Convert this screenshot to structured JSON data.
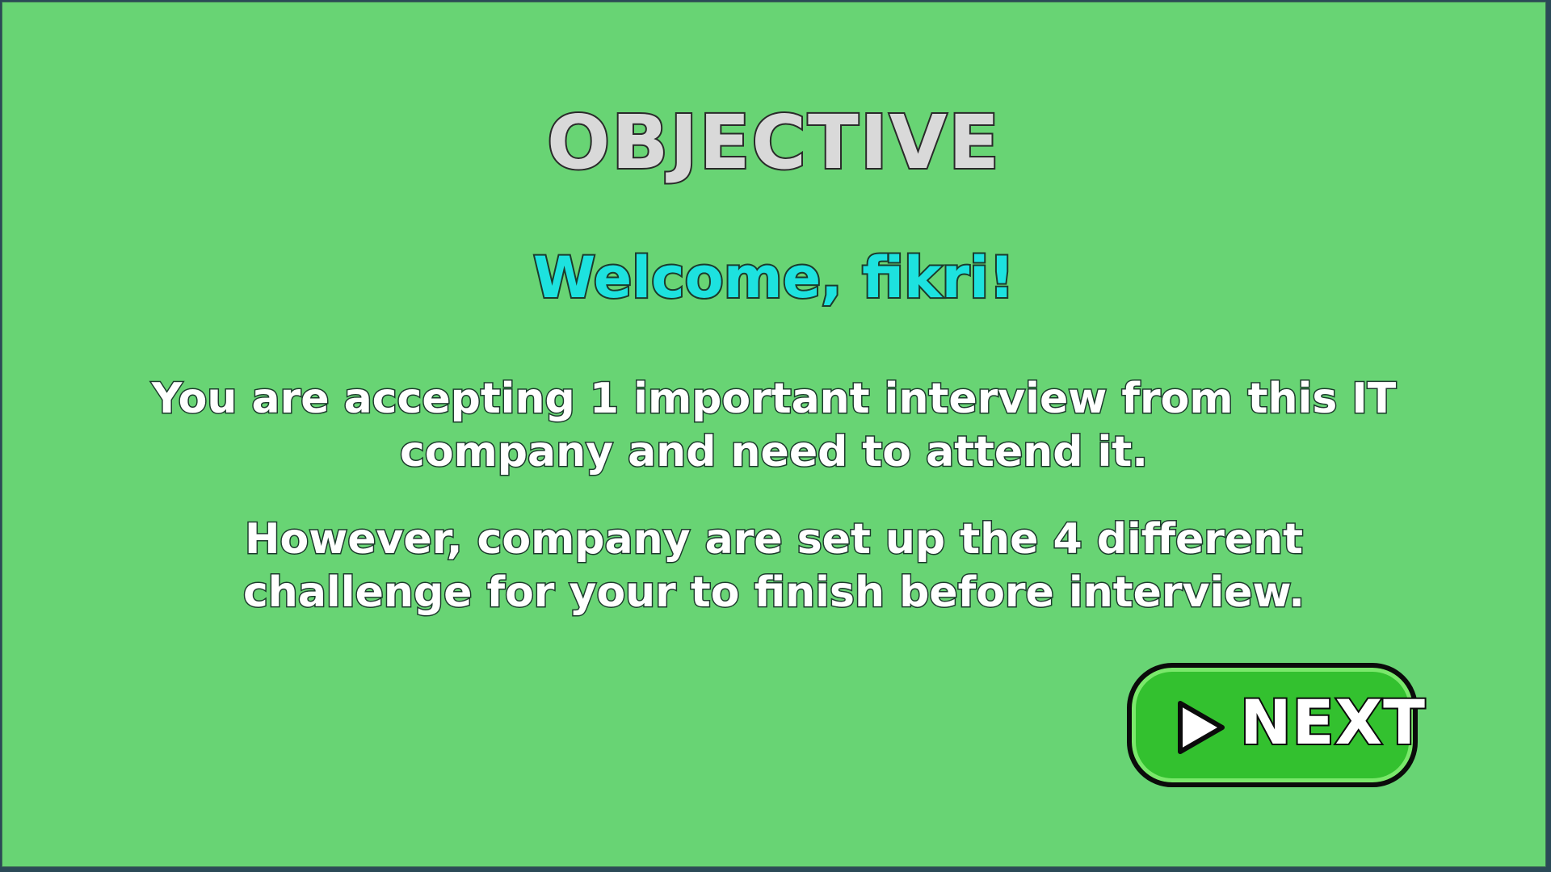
{
  "screen": {
    "title": "OBJECTIVE",
    "welcome": "Welcome, fikri!",
    "paragraph_1": "You are accepting 1 important interview from this IT company and need to attend it.",
    "paragraph_2": "However, company are set up the 4 different challenge for your to finish before interview."
  },
  "next_button": {
    "label": "NEXT",
    "icon": "play-icon"
  },
  "colors": {
    "background": "#68d474",
    "welcome_text": "#1de2df",
    "button": "#33c12f"
  }
}
